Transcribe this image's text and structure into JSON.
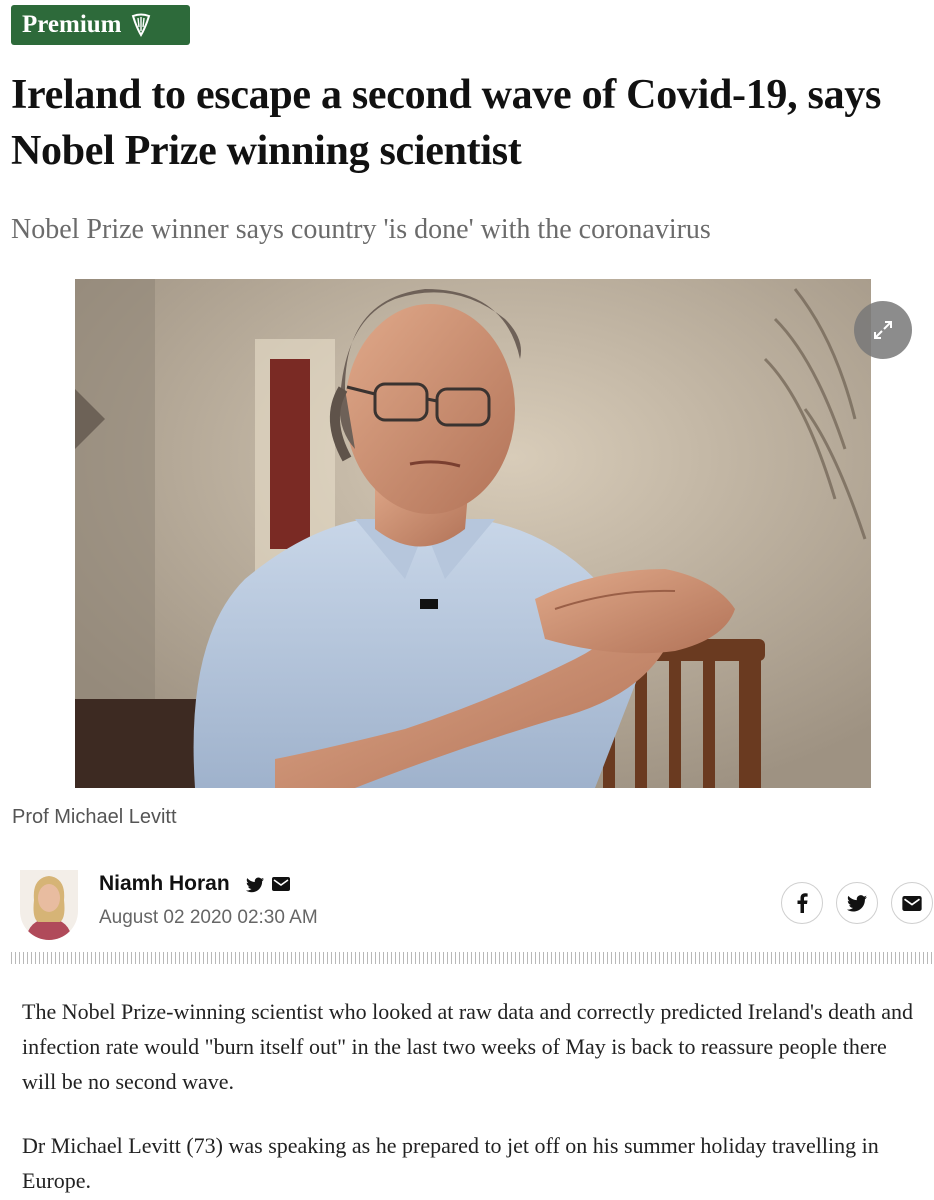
{
  "badge": {
    "label": "Premium",
    "icon": "harp-icon"
  },
  "article": {
    "headline": "Ireland to escape a second wave of Covid-19, says Nobel Prize winning scientist",
    "standfirst": "Nobel Prize winner says country 'is done' with the coronavirus",
    "image_caption": "Prof Michael Levitt",
    "paragraphs": [
      "The Nobel Prize-winning scientist who looked at raw data and correctly predicted Ireland's death and infection rate would \"burn itself out\" in the last two weeks of May is back to reassure people there will be no second wave.",
      "Dr Michael Levitt (73) was speaking as he prepared to jet off on his summer holiday travelling in Europe."
    ]
  },
  "author": {
    "name": "Niamh Horan",
    "date": "August 02 2020 02:30 AM",
    "icons": [
      "twitter-icon",
      "email-icon"
    ]
  },
  "share_buttons": [
    "facebook-icon",
    "twitter-icon",
    "email-icon"
  ],
  "colors": {
    "badge_bg": "#2d6a3a",
    "standfirst": "#6b6b6b",
    "meta": "#666666"
  }
}
